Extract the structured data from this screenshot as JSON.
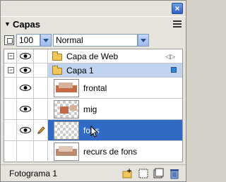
{
  "panel": {
    "title": "Capas",
    "close_label": "×"
  },
  "controls": {
    "opacity_value": "100",
    "blend_mode": "Normal"
  },
  "layers": [
    {
      "label": "Capa de Web",
      "kind": "folder",
      "expander": "−"
    },
    {
      "label": "Capa 1",
      "kind": "folder",
      "expander": "−"
    },
    {
      "label": "frontal",
      "kind": "image"
    },
    {
      "label": "mig",
      "kind": "image"
    },
    {
      "label": "fons",
      "kind": "image"
    },
    {
      "label": "recurs de fons",
      "kind": "image"
    }
  ],
  "footer": {
    "frame_label": "Fotograma 1"
  },
  "colors": {
    "selection": "#316ac5",
    "layer_color": "#2a8bd8"
  }
}
